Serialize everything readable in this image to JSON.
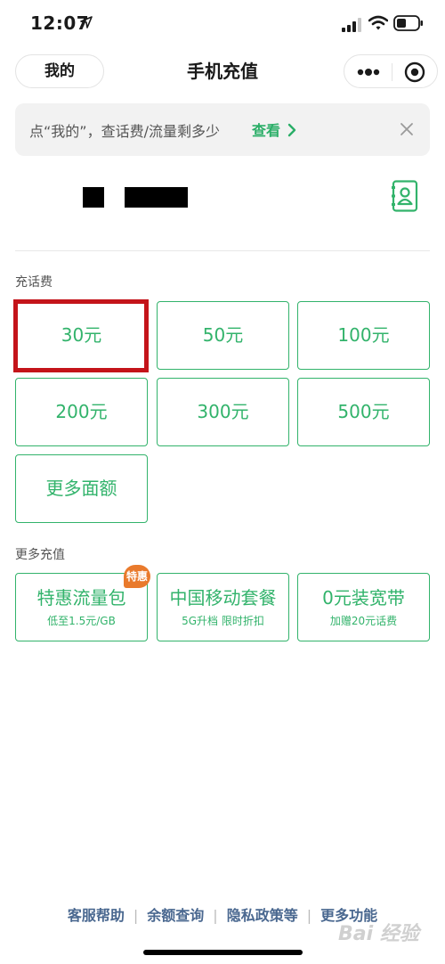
{
  "status_bar": {
    "time": "12:07"
  },
  "nav": {
    "mine_label": "我的",
    "title": "手机充值"
  },
  "banner": {
    "text": "点“我的”，查话费/流量剩多少",
    "link": "查看"
  },
  "section_recharge": {
    "label": "充话费"
  },
  "amounts": [
    "30元",
    "50元",
    "100元",
    "200元",
    "300元",
    "500元",
    "更多面额"
  ],
  "section_more": {
    "label": "更多充值"
  },
  "promos": [
    {
      "title": "特惠流量包",
      "sub": "低至1.5元/GB",
      "badge": "特惠"
    },
    {
      "title": "中国移动套餐",
      "sub": "5G升档 限时折扣"
    },
    {
      "title": "0元装宽带",
      "sub": "加赠20元话费"
    }
  ],
  "footer": {
    "links": [
      "客服帮助",
      "余额查询",
      "隐私政策等",
      "更多功能"
    ]
  },
  "watermark": "Bai 经验",
  "colors": {
    "accent": "#32b36b",
    "link": "#2aae67",
    "highlight": "#c4141a",
    "badge": "#e97a2c",
    "footer_link": "#4a6890"
  },
  "icons": [
    "location-arrow-icon",
    "signal-icon",
    "wifi-icon",
    "battery-icon",
    "more-dots-icon",
    "target-icon",
    "chevron-right-icon",
    "close-icon",
    "contacts-book-icon"
  ]
}
